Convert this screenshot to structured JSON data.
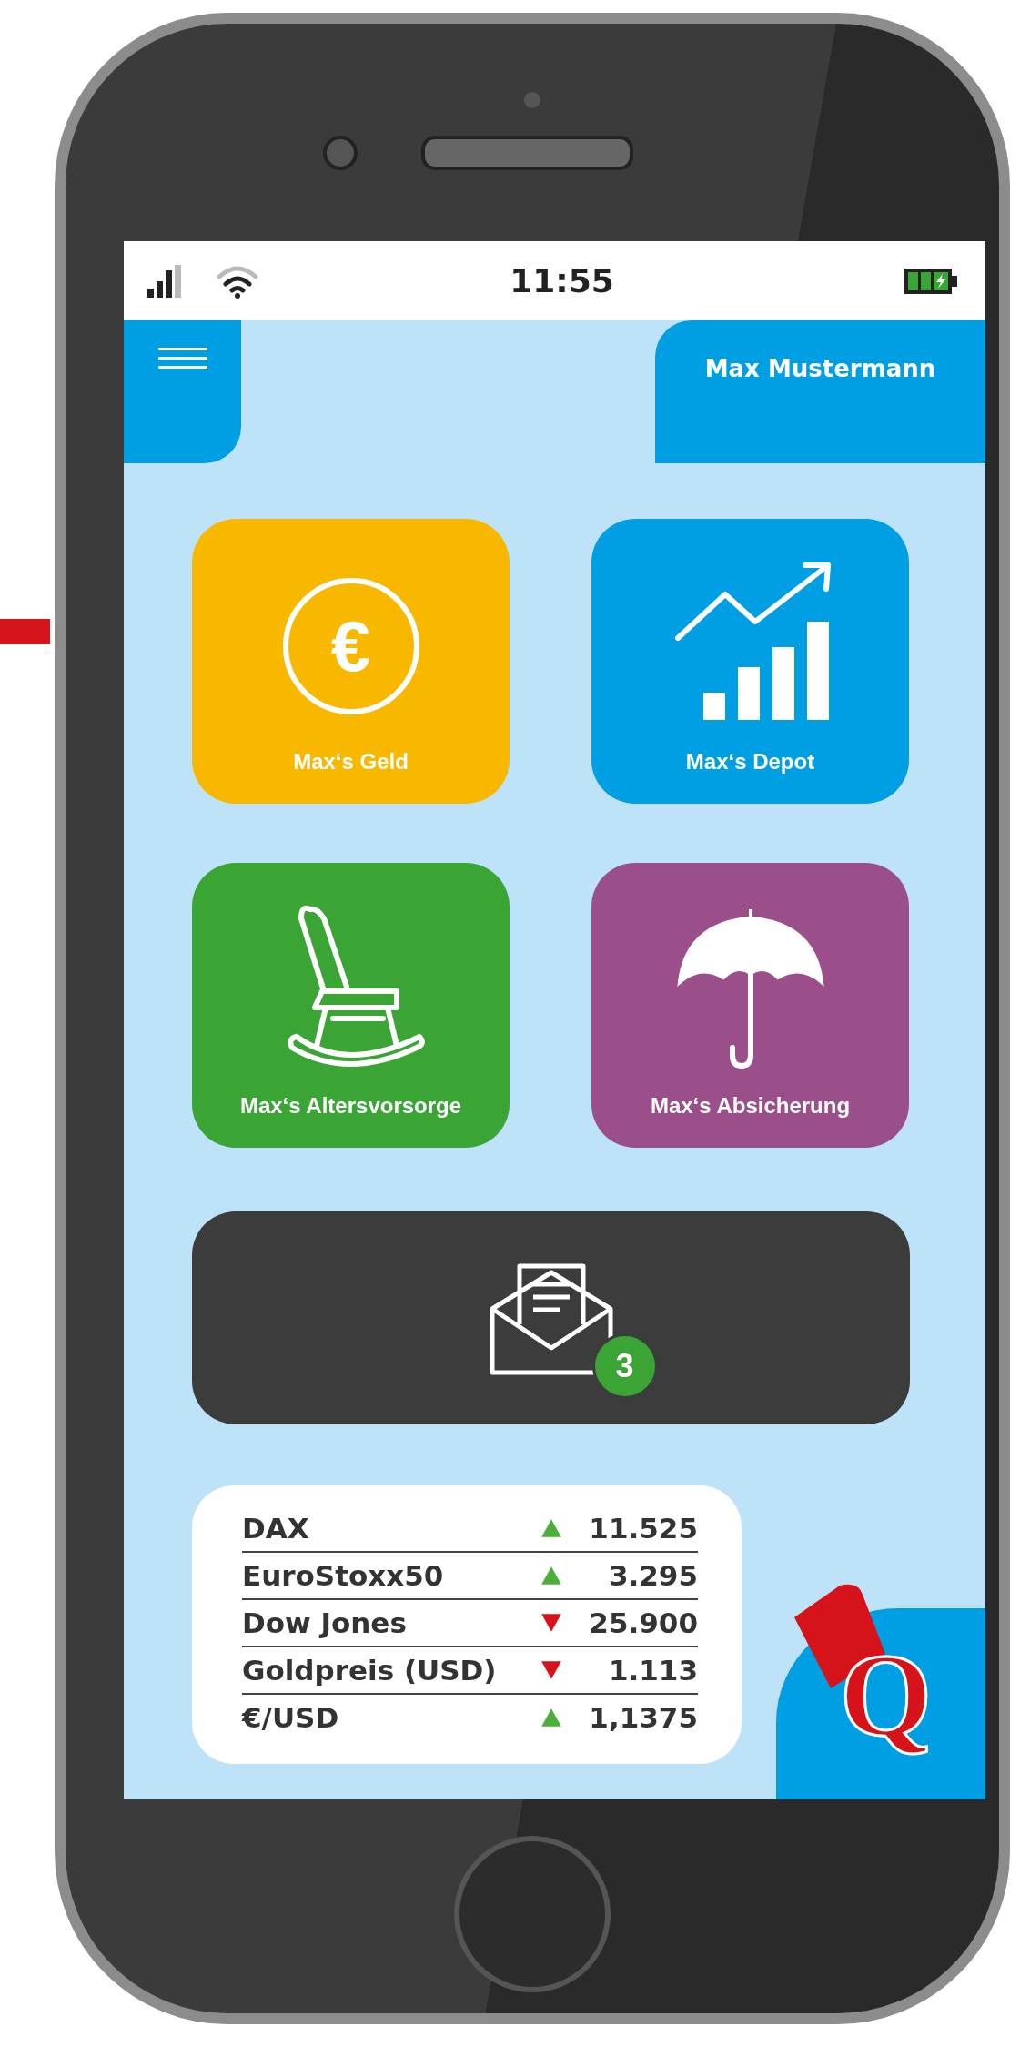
{
  "status_bar": {
    "time": "11:55"
  },
  "header": {
    "user_name": "Max Mustermann"
  },
  "tiles": [
    {
      "label": "Max‘s Geld",
      "kind": "money",
      "color": "#f9b800",
      "symbol": "€"
    },
    {
      "label": "Max‘s Depot",
      "kind": "depot",
      "color": "#009fe3"
    },
    {
      "label": "Max‘s Altersvorsorge",
      "kind": "pension",
      "color": "#3aa535"
    },
    {
      "label": "Max‘s Absicherung",
      "kind": "insurance",
      "color": "#9b4f8a"
    }
  ],
  "messages": {
    "badge": "3"
  },
  "ticker": [
    {
      "name": "DAX",
      "kind": "up",
      "value": "11.525"
    },
    {
      "name": "EuroStoxx50",
      "kind": "up",
      "value": "3.295"
    },
    {
      "name": "Dow Jones",
      "kind": "down",
      "value": "25.900"
    },
    {
      "name": "Goldpreis (USD)",
      "kind": "down",
      "value": "1.113"
    },
    {
      "name": "€/USD",
      "kind": "up",
      "value": "1,1375"
    }
  ],
  "logo": {
    "letter": "Q"
  }
}
